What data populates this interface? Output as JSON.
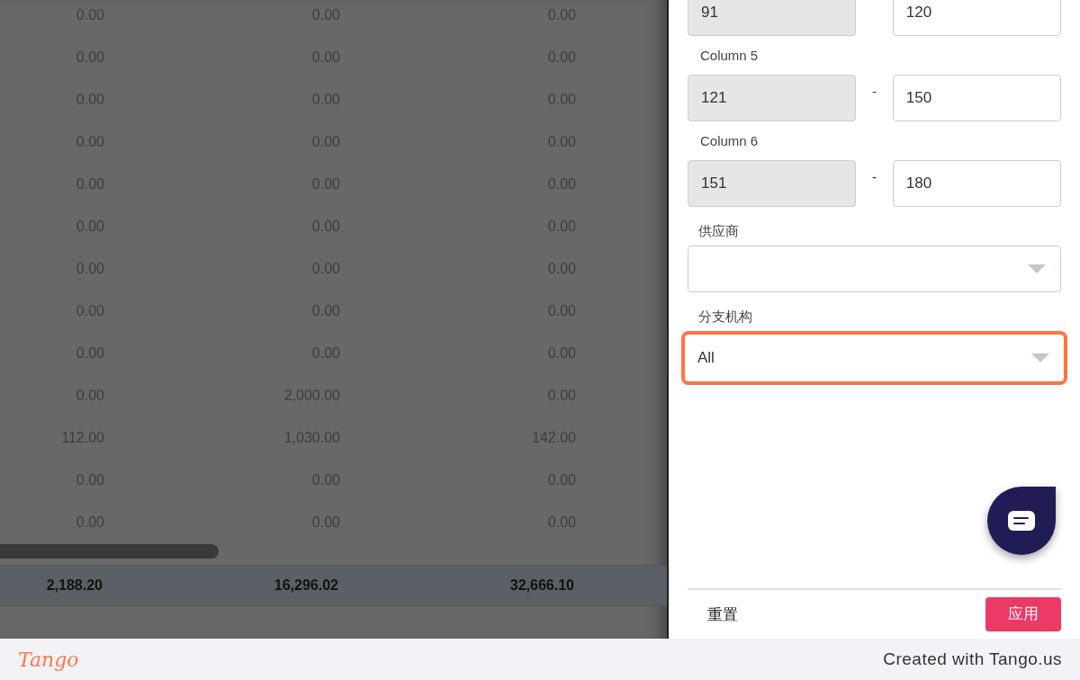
{
  "table": {
    "rows": [
      [
        "0.00",
        "0.00",
        "0.00"
      ],
      [
        "0.00",
        "0.00",
        "0.00"
      ],
      [
        "0.00",
        "0.00",
        "0.00"
      ],
      [
        "0.00",
        "0.00",
        "0.00"
      ],
      [
        "0.00",
        "0.00",
        "0.00"
      ],
      [
        "0.00",
        "0.00",
        "0.00"
      ],
      [
        "0.00",
        "0.00",
        "0.00"
      ],
      [
        "0.00",
        "0.00",
        "0.00"
      ],
      [
        "0.00",
        "0.00",
        "0.00"
      ],
      [
        "0.00",
        "2,000.00",
        "0.00"
      ],
      [
        "112.00",
        "1,030.00",
        "142.00"
      ],
      [
        "0.00",
        "0.00",
        "0.00"
      ],
      [
        "0.00",
        "0.00",
        "0.00"
      ]
    ],
    "totals": [
      "2,188.20",
      "16,296.02",
      "32,666.10"
    ]
  },
  "filter_panel": {
    "ranges": [
      {
        "from": "91",
        "to": "120"
      },
      {
        "label": "Column 5",
        "from": "121",
        "separator": "-",
        "to": "150"
      },
      {
        "label": "Column 6",
        "from": "151",
        "separator": "-",
        "to": "180"
      }
    ],
    "selects": [
      {
        "label": "供应商",
        "highlighted": false
      },
      {
        "label": "分支机构",
        "value": "All",
        "highlighted": true
      }
    ],
    "reset_button": "重置",
    "apply_button": "应用"
  },
  "footer": {
    "logo": "Tango",
    "credit": "Created with Tango.us"
  }
}
